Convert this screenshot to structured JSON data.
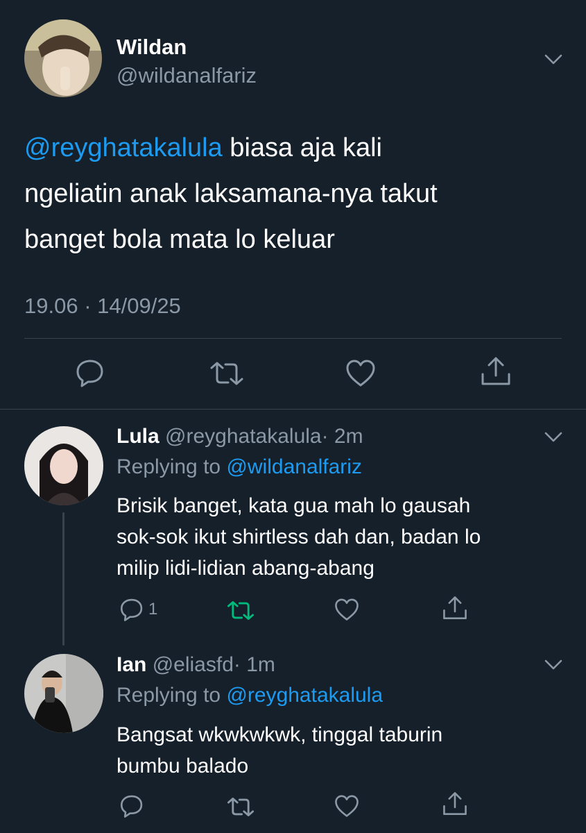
{
  "main_tweet": {
    "author_name": "Wildan",
    "author_handle": "@wildanalfariz",
    "mention": "@reyghatakalula",
    "text_line1": " biasa aja kali",
    "text_line2": "ngeliatin anak laksamana-nya takut",
    "text_line3": "banget bola mata lo keluar",
    "timestamp": "19.06 · 14/09/25"
  },
  "replies": [
    {
      "author_name": "Lula",
      "author_handle": "@reyghatakalula",
      "time": "· 2m",
      "replying_to_label": "Replying to ",
      "replying_to_handle": "@wildanalfariz",
      "text_line1": "Brisik banget, kata gua mah lo gausah",
      "text_line2": "sok-sok ikut shirtless dah dan, badan lo",
      "text_line3": "milip lidi-lidian abang-abang",
      "reply_count": "1",
      "retweeted": true
    },
    {
      "author_name": "Ian",
      "author_handle": "@eliasfd",
      "time": "· 1m",
      "replying_to_label": "Replying to ",
      "replying_to_handle": "@reyghatakalula",
      "text_line1": "Bangsat wkwkwkwk, tinggal taburin",
      "text_line2": "bumbu balado"
    }
  ],
  "colors": {
    "background": "#15202b",
    "accent": "#1d9bf0",
    "muted": "#8b98a5",
    "retweet_active": "#00ba7c",
    "divider": "#38444d"
  },
  "icons": [
    "chevron-down-icon",
    "reply-icon",
    "retweet-icon",
    "like-icon",
    "share-icon"
  ]
}
